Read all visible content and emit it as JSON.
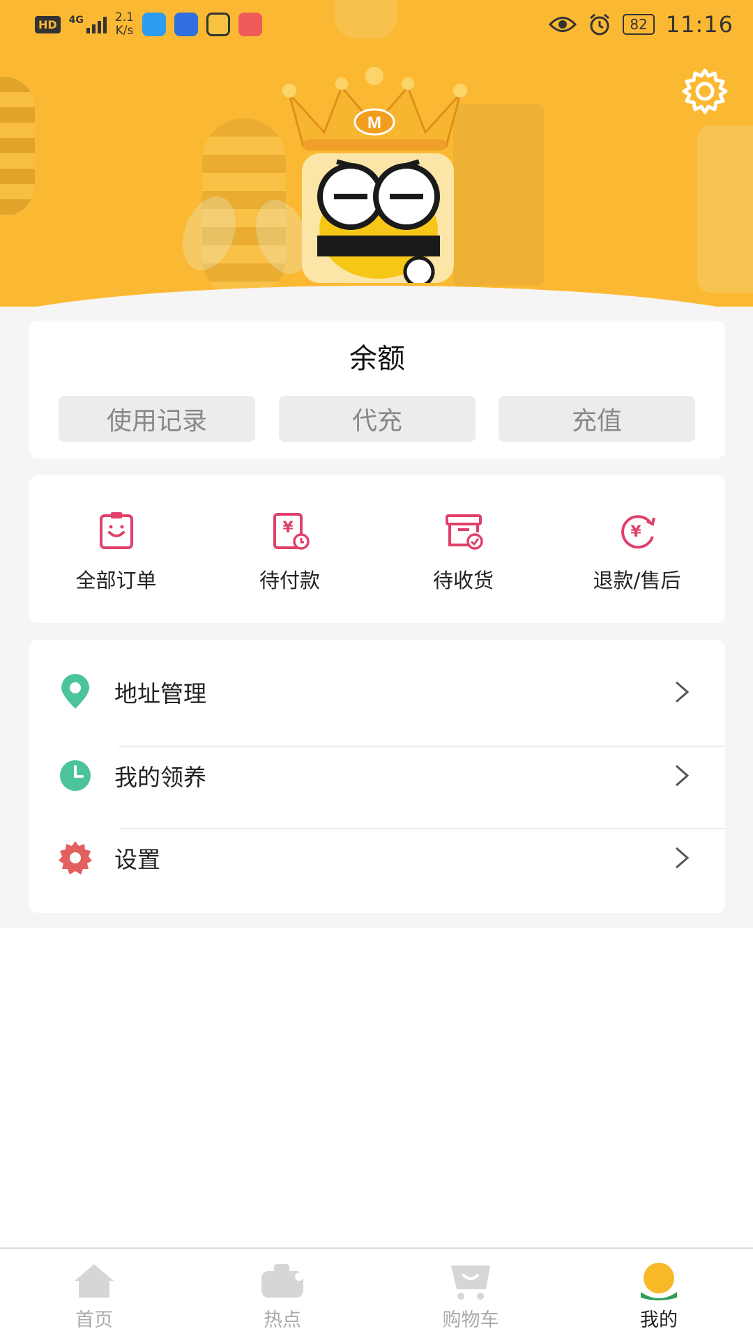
{
  "status_bar": {
    "network": "HD",
    "signal_type": "4G",
    "speed_value": "2.1",
    "speed_unit": "K/s",
    "battery": "82",
    "time": "11:16"
  },
  "header": {
    "crown_letter": "M",
    "background_color": "#fbb933"
  },
  "balance": {
    "title": "余额",
    "buttons": [
      "使用记录",
      "代充",
      "充值"
    ]
  },
  "orders": {
    "items": [
      {
        "label": "全部订单",
        "icon": "clipboard-smile-icon"
      },
      {
        "label": "待付款",
        "icon": "payment-pending-icon"
      },
      {
        "label": "待收货",
        "icon": "receive-box-icon"
      },
      {
        "label": "退款/售后",
        "icon": "refund-icon"
      }
    ],
    "icon_color": "#e0406a"
  },
  "menu": {
    "items": [
      {
        "label": "地址管理",
        "icon": "location-pin-icon",
        "color": "#4cc49a"
      },
      {
        "label": "我的领养",
        "icon": "clock-icon",
        "color": "#4cc49a"
      },
      {
        "label": "设置",
        "icon": "gear-icon",
        "color": "#e2605d"
      }
    ]
  },
  "tabbar": {
    "items": [
      {
        "label": "首页",
        "icon": "home-icon"
      },
      {
        "label": "热点",
        "icon": "hot-icon"
      },
      {
        "label": "购物车",
        "icon": "cart-icon"
      },
      {
        "label": "我的",
        "icon": "profile-icon"
      }
    ],
    "active_index": 3
  }
}
